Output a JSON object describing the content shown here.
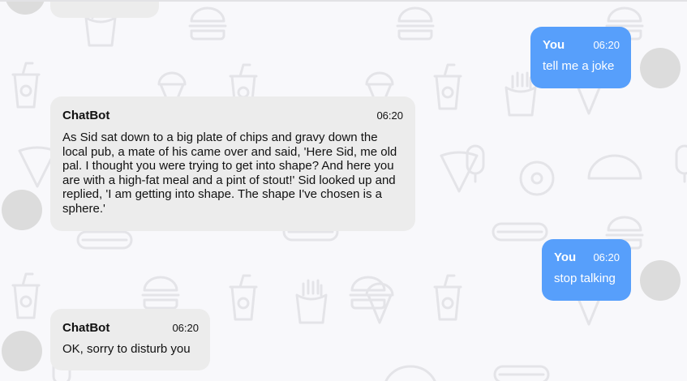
{
  "colors": {
    "background": "#f8f8fb",
    "bot_bubble": "#ececec",
    "user_bubble": "#579ffb",
    "avatar": "#dcdcdc",
    "pattern": "#e6e6ea"
  },
  "messages": [
    {
      "sender": "You",
      "time": "06:20",
      "text": "tell me a joke"
    },
    {
      "sender": "ChatBot",
      "time": "06:20",
      "text": "As Sid sat down to a big plate of chips and gravy down the local pub, a mate of his came over and said, 'Here Sid, me old pal. I thought you were trying to get into shape? And here you are with a high-fat meal and a pint of stout!' Sid looked up and replied, 'I am getting into shape. The shape I've chosen is a sphere.'"
    },
    {
      "sender": "You",
      "time": "06:20",
      "text": "stop talking"
    },
    {
      "sender": "ChatBot",
      "time": "06:20",
      "text": "OK, sorry to disturb you"
    }
  ]
}
